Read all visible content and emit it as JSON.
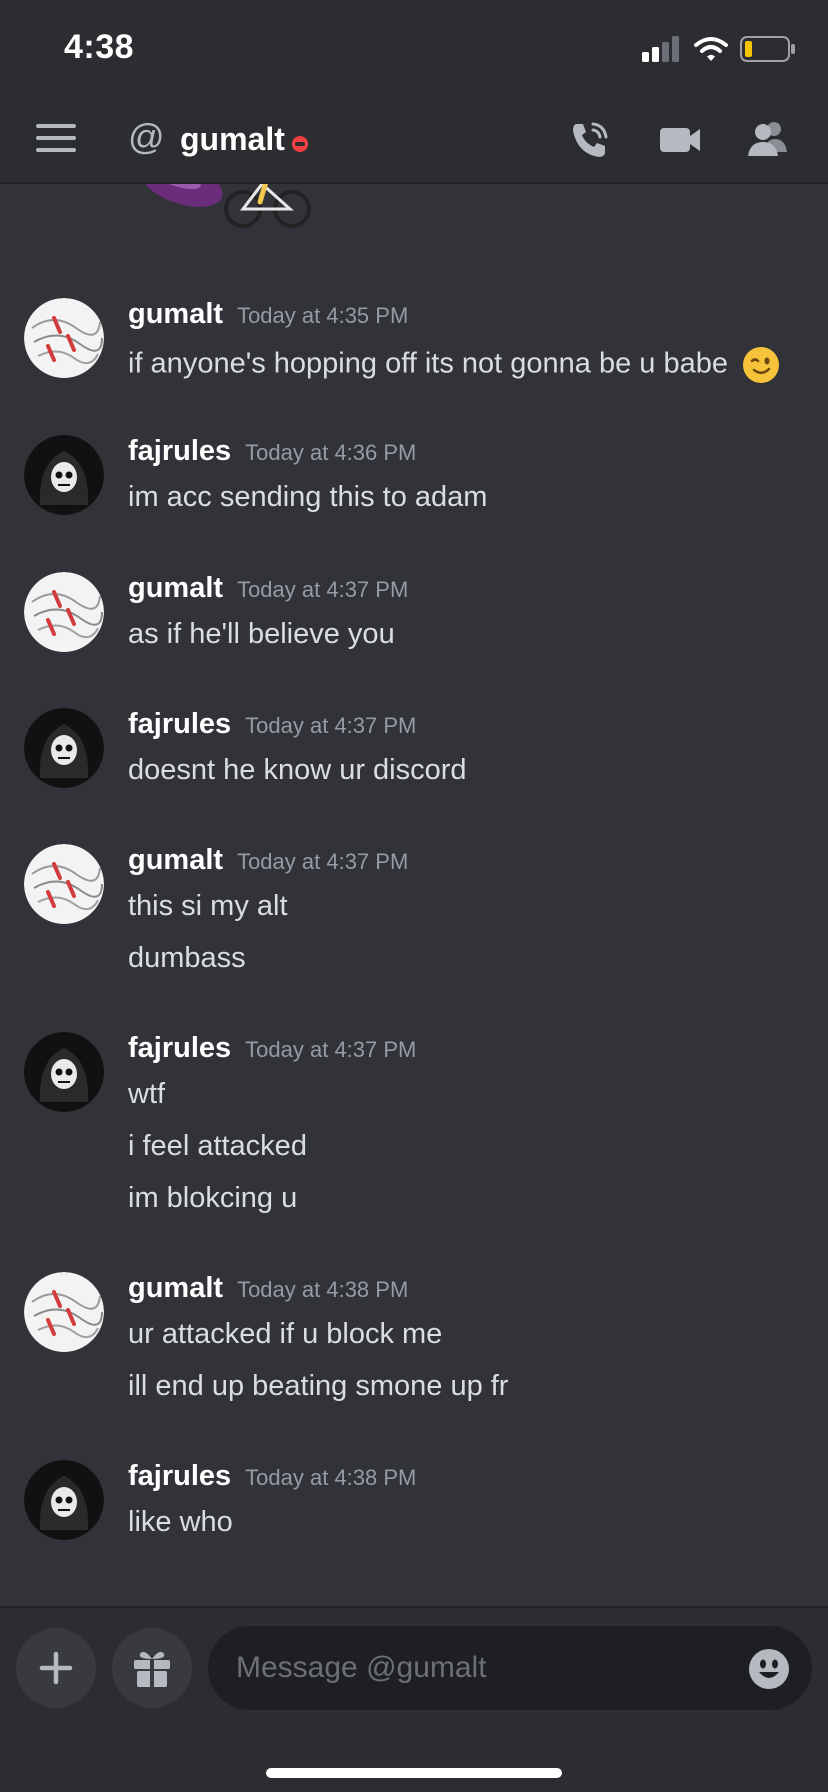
{
  "status_bar": {
    "time": "4:38"
  },
  "header": {
    "at_symbol": "@",
    "title": "gumalt"
  },
  "messages": [
    {
      "author": "gumalt",
      "timestamp": "Today at 4:35 PM",
      "lines": [
        "if anyone's hopping off its not gonna be u babe"
      ]
    },
    {
      "author": "fajrules",
      "timestamp": "Today at 4:36 PM",
      "lines": [
        "im acc sending this to adam"
      ]
    },
    {
      "author": "gumalt",
      "timestamp": "Today at 4:37 PM",
      "lines": [
        "as if he'll believe you"
      ]
    },
    {
      "author": "fajrules",
      "timestamp": "Today at 4:37 PM",
      "lines": [
        "doesnt he know ur discord"
      ]
    },
    {
      "author": "gumalt",
      "timestamp": "Today at 4:37 PM",
      "lines": [
        "this si my alt",
        "dumbass"
      ]
    },
    {
      "author": "fajrules",
      "timestamp": "Today at 4:37 PM",
      "lines": [
        "wtf",
        "i feel attacked",
        "im blokcing u"
      ]
    },
    {
      "author": "gumalt",
      "timestamp": "Today at 4:38 PM",
      "lines": [
        "ur attacked if u block me",
        "ill end up beating smone up fr"
      ]
    },
    {
      "author": "fajrules",
      "timestamp": "Today at 4:38 PM",
      "lines": [
        "like who"
      ]
    }
  ],
  "composer": {
    "placeholder": "Message @gumalt"
  },
  "icons": {
    "menu": "hamburger-menu-icon",
    "call": "phone-call-icon",
    "video": "video-camera-icon",
    "members": "members-icon",
    "add": "plus-icon",
    "gift": "gift-icon",
    "emoji": "smiley-face-icon"
  },
  "colors": {
    "background": "#313338",
    "header": "#2b2d31",
    "dnd": "#f23f43",
    "timestamp": "#949ba4"
  }
}
